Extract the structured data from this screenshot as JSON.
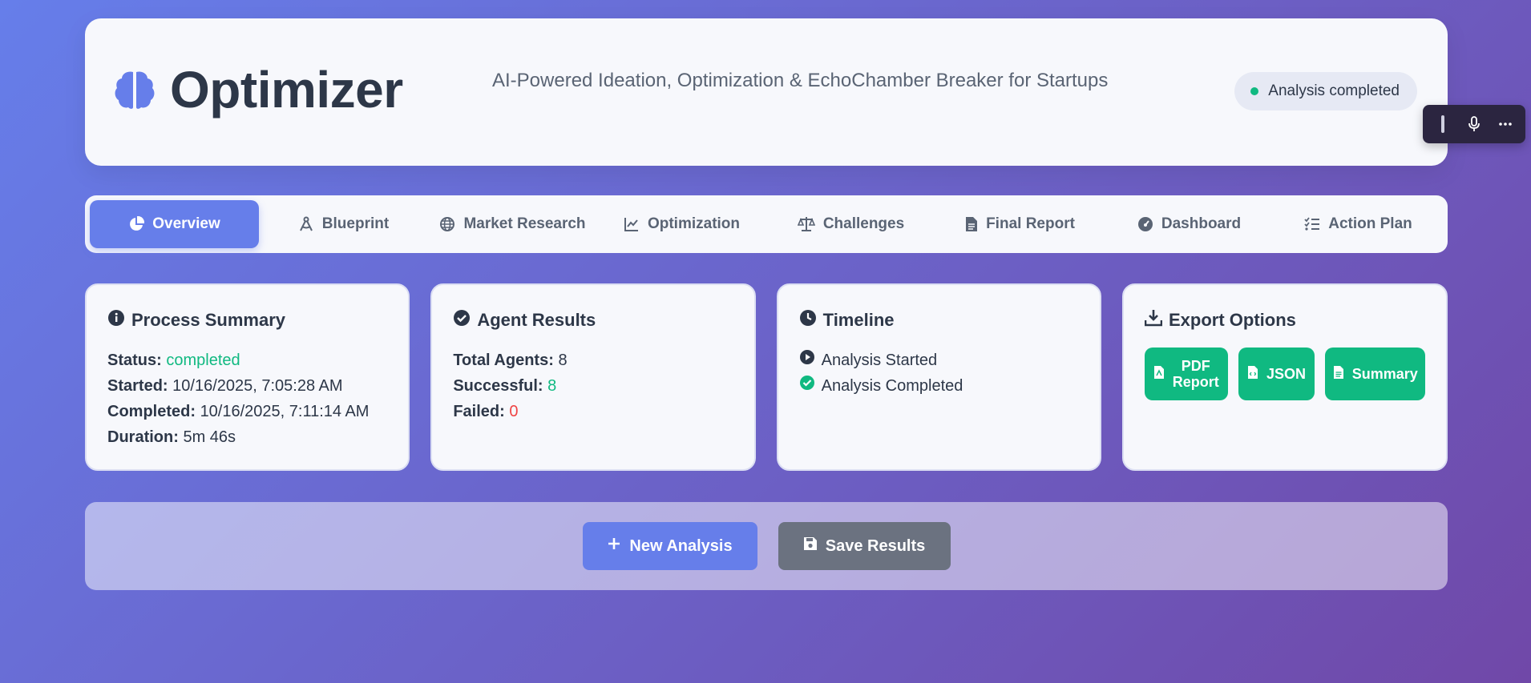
{
  "header": {
    "title": "Optimizer",
    "tagline": "AI-Powered Ideation, Optimization & EchoChamber Breaker for Startups",
    "status": "Analysis completed",
    "logo_icon": "brain-icon"
  },
  "tabs": [
    {
      "label": "Overview",
      "icon": "chart-pie-icon",
      "active": true
    },
    {
      "label": "Blueprint",
      "icon": "compass-drafting-icon"
    },
    {
      "label": "Market Research",
      "icon": "globe-icon"
    },
    {
      "label": "Optimization",
      "icon": "chart-line-icon"
    },
    {
      "label": "Challenges",
      "icon": "balance-scale-icon"
    },
    {
      "label": "Final Report",
      "icon": "file-icon"
    },
    {
      "label": "Dashboard",
      "icon": "gauge-icon"
    },
    {
      "label": "Action Plan",
      "icon": "list-check-icon"
    }
  ],
  "process_summary": {
    "title": "Process Summary",
    "status_label": "Status:",
    "status_value": "completed",
    "started_label": "Started:",
    "started_value": "10/16/2025, 7:05:28 AM",
    "completed_label": "Completed:",
    "completed_value": "10/16/2025, 7:11:14 AM",
    "duration_label": "Duration:",
    "duration_value": "5m 46s"
  },
  "agent_results": {
    "title": "Agent Results",
    "total_label": "Total Agents:",
    "total_value": "8",
    "successful_label": "Successful:",
    "successful_value": "8",
    "failed_label": "Failed:",
    "failed_value": "0"
  },
  "timeline": {
    "title": "Timeline",
    "items": [
      "Analysis Started",
      "Analysis Completed"
    ]
  },
  "export": {
    "title": "Export Options",
    "pdf_line1": "PDF",
    "pdf_line2": "Report",
    "json": "JSON",
    "summary": "Summary"
  },
  "actions": {
    "new_analysis": "New Analysis",
    "save_results": "Save Results"
  },
  "colors": {
    "accent": "#667eea",
    "success": "#10b981",
    "danger": "#ef4444",
    "secondary": "#6b7280"
  }
}
